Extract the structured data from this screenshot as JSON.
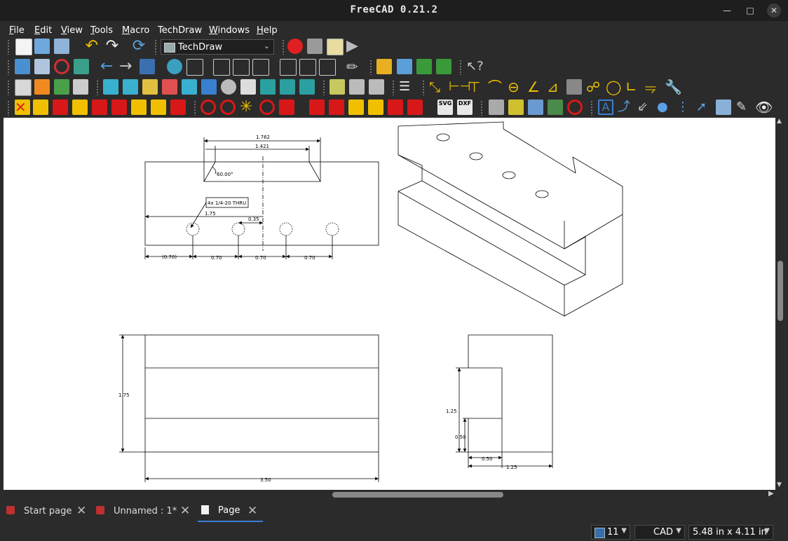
{
  "window": {
    "title": "FreeCAD 0.21.2"
  },
  "menu": [
    {
      "id": "file",
      "mn": "F",
      "rest": "ile"
    },
    {
      "id": "edit",
      "mn": "E",
      "rest": "dit"
    },
    {
      "id": "view",
      "mn": "V",
      "rest": "iew"
    },
    {
      "id": "tools",
      "mn": "T",
      "rest": "ools"
    },
    {
      "id": "macro",
      "mn": "M",
      "rest": "acro"
    },
    {
      "id": "techdraw",
      "mn": "",
      "rest": "TechDraw"
    },
    {
      "id": "windows",
      "mn": "W",
      "rest": "indows"
    },
    {
      "id": "help",
      "mn": "H",
      "rest": "elp"
    }
  ],
  "toolbar": {
    "workbench": "TechDraw"
  },
  "colors": {
    "accent": "#3b7dd8",
    "record": "#e02020",
    "techdraw_yellow": "#f0c000",
    "techdraw_red": "#d81818"
  },
  "drawing": {
    "top_view": {
      "dim_total": "1.762",
      "dim_inner": "1.421",
      "angle": "60.00°",
      "note": "4x 1/4-20 THRU",
      "dim_175": "1.75",
      "dim_035": "0.35",
      "dim_first": "(0.70)",
      "dim_a": "0.70",
      "dim_b": "0.70",
      "dim_c": "0.70"
    },
    "front_view": {
      "height": "1.75",
      "width": "3.50"
    },
    "side_view": {
      "h125": "1.25",
      "h050": "0.50",
      "w050": "0.50",
      "w125": "1.25"
    }
  },
  "tabs": [
    {
      "label": "Start page"
    },
    {
      "label": "Unnamed : 1*"
    },
    {
      "label": "Page"
    }
  ],
  "status": {
    "count": "11",
    "nav_style": "CAD",
    "page_size": "5.48 in x 4.11 in"
  }
}
